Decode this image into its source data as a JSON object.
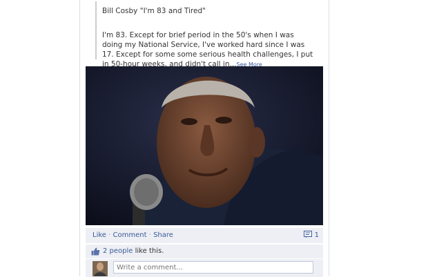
{
  "post": {
    "note_title": "Bill Cosby \"I'm 83 and Tired\"",
    "note_excerpt": "I'm 83. Except for brief period in the 50's when I was doing my National Service, I've worked hard since I was 17. Except for some some serious health challenges, I put in 50-hour weeks, and didn't call in...",
    "see_more": "See More",
    "photo_icon": "portrait-photo"
  },
  "actions": {
    "like": "Like",
    "comment": "Comment",
    "share": "Share",
    "separator": "·",
    "comment_count": "1"
  },
  "likes": {
    "count_link": "2 people",
    "suffix": " like this."
  },
  "comment_box": {
    "placeholder": "Write a comment..."
  },
  "colors": {
    "link": "#3b5998",
    "panel": "#edeff4"
  }
}
